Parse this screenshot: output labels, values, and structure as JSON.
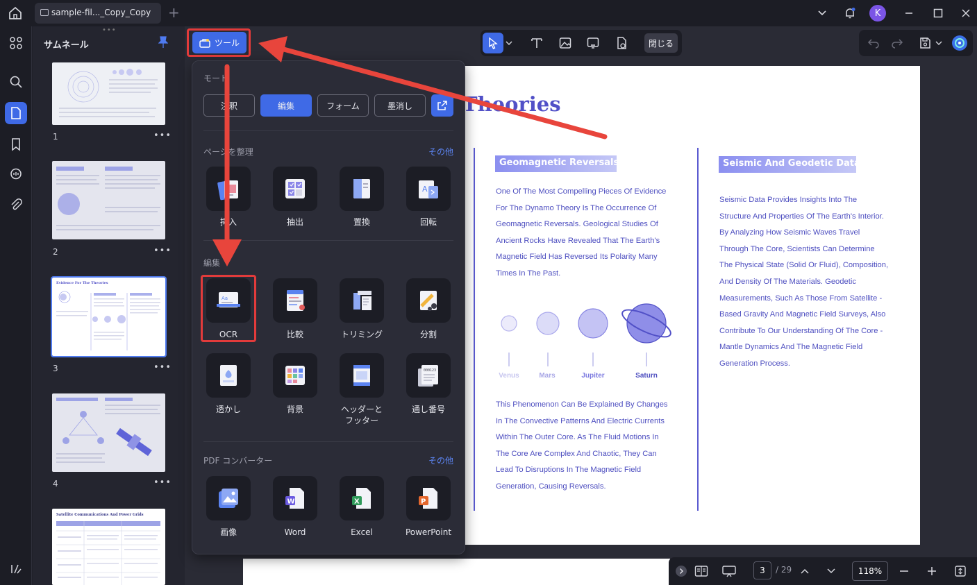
{
  "tab": {
    "label": "sample-fil..._Copy_Copy"
  },
  "user": {
    "initial": "K"
  },
  "thumbnails": {
    "title": "サムネール",
    "pages": [
      {
        "num": "1"
      },
      {
        "num": "2"
      },
      {
        "num": "3"
      },
      {
        "num": "4"
      }
    ],
    "page5_title": "Satellite Communications And Power Grids",
    "page3_title": "Evidence For The Theories"
  },
  "toolbar": {
    "close_label": "閉じる"
  },
  "tools_button": {
    "label": "ツール"
  },
  "popup": {
    "mode_label": "モード",
    "modes": [
      "注釈",
      "編集",
      "フォーム",
      "墨消し"
    ],
    "organize_label": "ページを整理",
    "organize_more": "その他",
    "organize_items": [
      "挿入",
      "抽出",
      "置換",
      "回転"
    ],
    "edit_label": "編集",
    "edit_items": [
      "OCR",
      "比較",
      "トリミング",
      "分割"
    ],
    "edit_items2": [
      "透かし",
      "背景",
      "ヘッダーと\nフッター",
      "通し番号"
    ],
    "converter_label": "PDF コンバーター",
    "converter_more": "その他",
    "converter_items": [
      "画像",
      "Word",
      "Excel",
      "PowerPoint"
    ]
  },
  "doc": {
    "title": "Theories",
    "left_header": "Geomagnetic Reversals",
    "left_para": [
      "One Of The Most Compelling Pieces Of Evidence",
      "For The Dynamo Theory Is The Occurrence Of",
      "Geomagnetic Reversals. Geological Studies Of",
      "Ancient Rocks Have Revealed That The Earth's",
      "Magnetic Field Has Reversed Its Polarity Many",
      "Times In The Past."
    ],
    "planets": [
      "Venus",
      "Mars",
      "Jupiter",
      "Saturn"
    ],
    "left_para2": [
      "This Phenomenon Can Be Explained By Changes",
      "In The Convective Patterns And Electric Currents",
      "Within The Outer Core. As The Fluid Motions In",
      "The Core Are Complex And Chaotic, They Can",
      "Lead To Disruptions In The Magnetic Field",
      "Generation, Causing Reversals."
    ],
    "right_header": "Seismic And Geodetic Data",
    "right_para": [
      "Seismic Data Provides Insights Into The",
      "Structure And Properties Of The Earth's Interior.",
      "By Analyzing How Seismic Waves Travel",
      "Through The Core, Scientists Can Determine",
      "The Physical State (Solid Or Fluid), Composition,",
      "And Density Of The Materials. Geodetic",
      "Measurements, Such As Those From Satellite -",
      "Based Gravity And Magnetic Field Surveys, Also",
      "Contribute To Our Understanding Of The Core -",
      "Mantle Dynamics And The Magnetic Field",
      "Generation Process."
    ]
  },
  "pagenav": {
    "current": "3",
    "total": "/ 29",
    "zoom": "118%"
  },
  "colors": {
    "accent": "#3f6ae6",
    "highlight": "#e23b3b",
    "doc_text": "#4e4fc0"
  }
}
